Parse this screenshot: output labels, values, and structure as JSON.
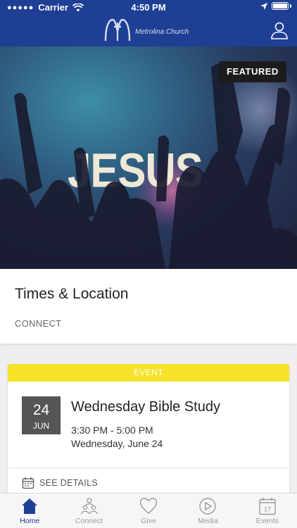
{
  "status_bar": {
    "carrier": "Carrier",
    "time": "4:50 PM"
  },
  "header": {
    "brand_name": "Metrolina Church",
    "colors": {
      "bar": "#1e3f94"
    }
  },
  "hero": {
    "image_text": "JESUS",
    "badge": "FEATURED"
  },
  "times_card": {
    "title": "Times & Location",
    "subtitle": "CONNECT"
  },
  "event_card": {
    "band_label": "EVENT",
    "band_color": "#f5e229",
    "day": "24",
    "month": "JUN",
    "title": "Wednesday Bible Study",
    "time_range": "3:30 PM - 5:00 PM",
    "date": "Wednesday, June 24",
    "details_label": "SEE DETAILS"
  },
  "tabbar": {
    "active_tab": "Home",
    "tabs": [
      {
        "label": "Home",
        "icon": "home-icon"
      },
      {
        "label": "Connect",
        "icon": "people-icon"
      },
      {
        "label": "Give",
        "icon": "heart-icon"
      },
      {
        "label": "Media",
        "icon": "play-icon"
      },
      {
        "label": "Events",
        "icon": "calendar-icon",
        "icon_text": "17"
      }
    ]
  }
}
